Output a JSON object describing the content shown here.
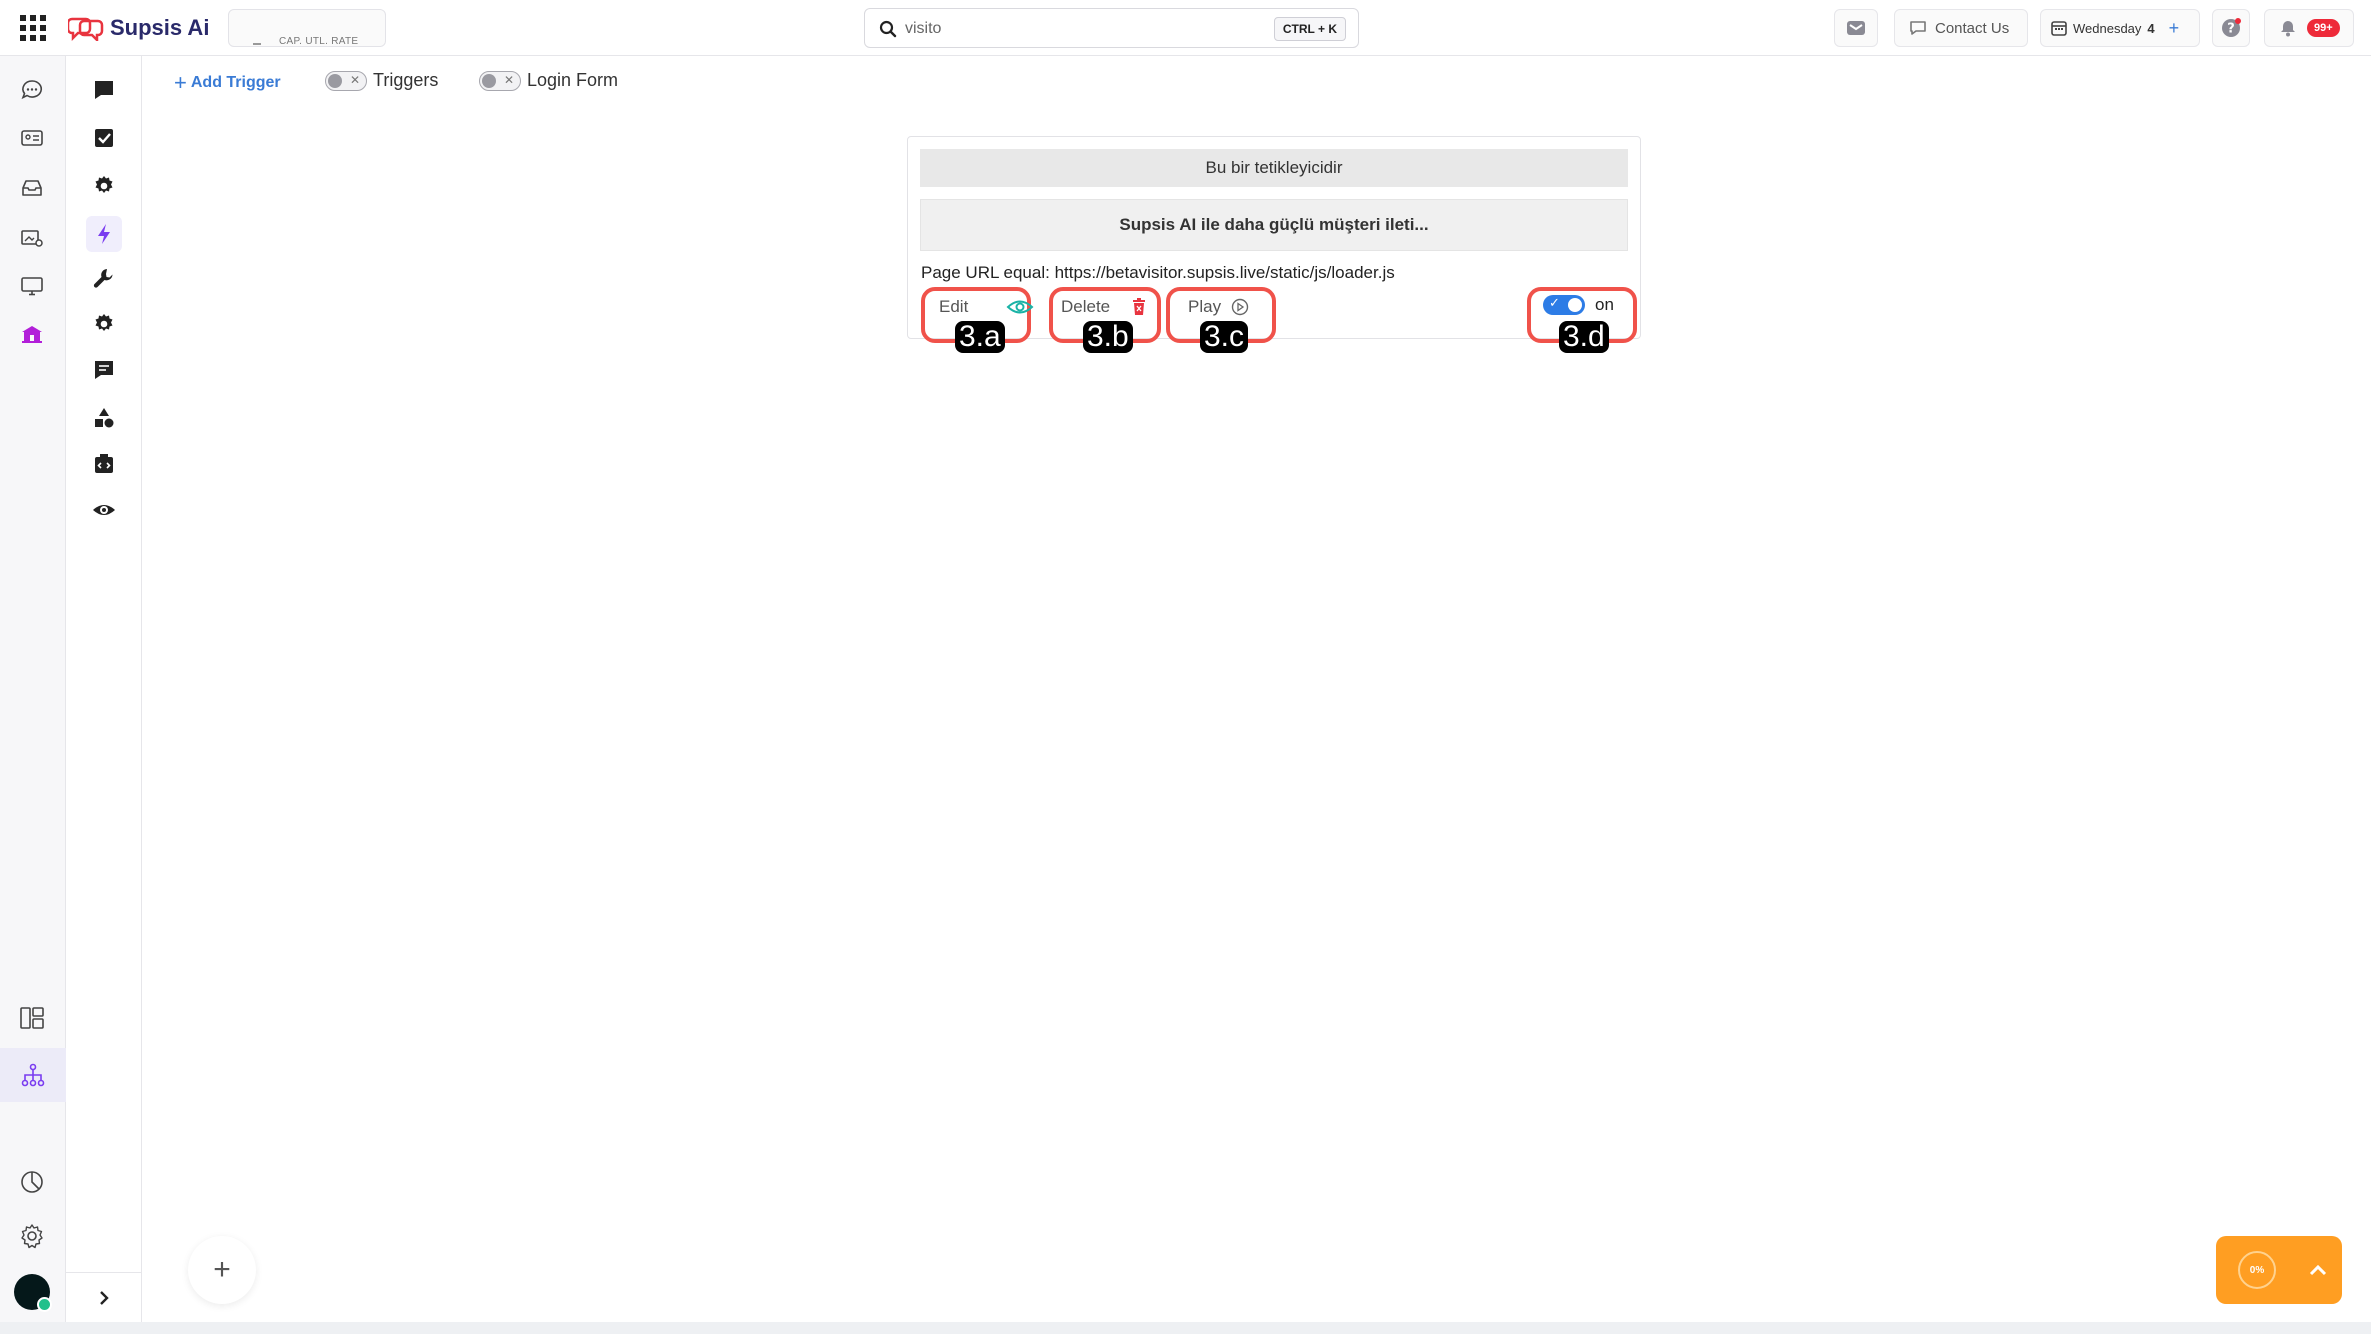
{
  "app": {
    "title": "Supsis Ai",
    "rate_label": "CAP. UTL. RATE"
  },
  "search": {
    "value": "visito",
    "shortcut": "CTRL + K"
  },
  "header": {
    "contact_label": "Contact Us",
    "day_label": "Wednesday",
    "day_number": "4",
    "notifications_badge": "99+"
  },
  "toolbar": {
    "add_trigger_label": "Add Trigger",
    "triggers_label": "Triggers",
    "login_form_label": "Login Form"
  },
  "trigger_card": {
    "title": "Bu bir tetikleyicidir",
    "message": "Supsis AI ile daha güçlü müşteri ileti...",
    "condition": "Page URL equal: https://betavisitor.supsis.live/static/js/loader.js",
    "edit_label": "Edit",
    "delete_label": "Delete",
    "play_label": "Play",
    "status_label": "on"
  },
  "annotations": {
    "edit": "3.a",
    "delete": "3.b",
    "play": "3.c",
    "toggle": "3.d"
  },
  "progress": {
    "percent_label": "0%"
  },
  "colors": {
    "accent": "#3a7bd5",
    "annotation": "#f0524a",
    "fab": "#ff9e22",
    "active_rail": "#7a3cf0",
    "home_icon": "#b21fd9"
  }
}
